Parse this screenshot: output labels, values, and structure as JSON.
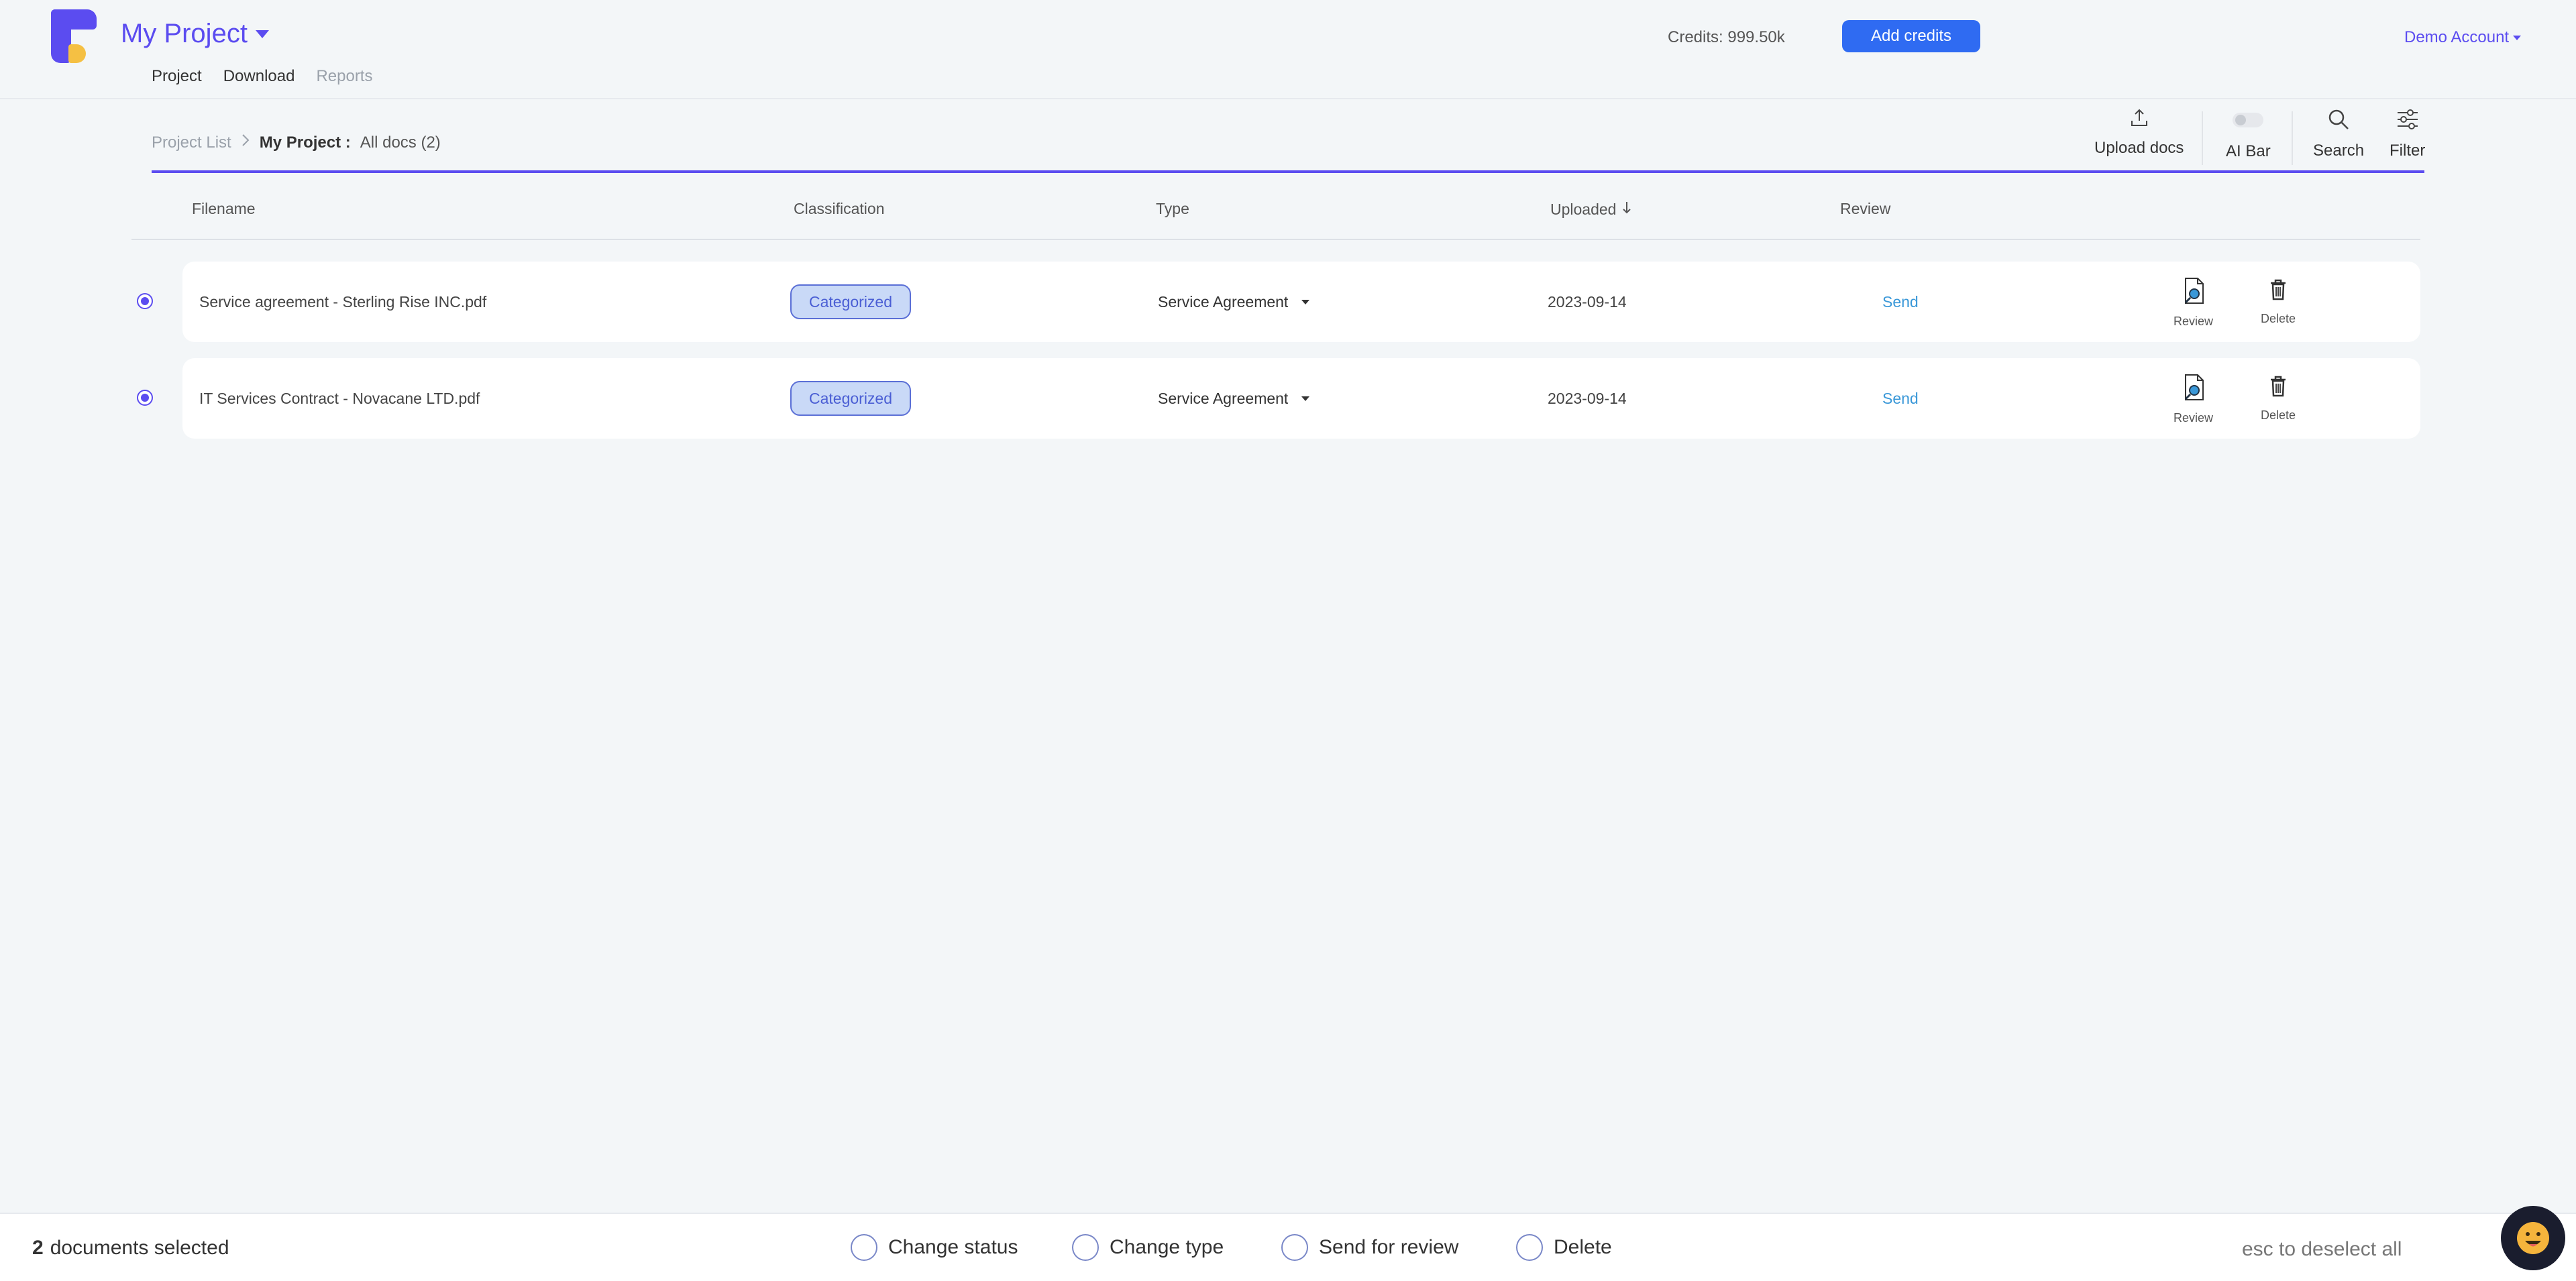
{
  "app": {
    "project_name": "My Project",
    "nav": [
      "Project",
      "Download",
      "Reports"
    ],
    "credits": "Credits: 999.50k",
    "add_credits_label": "Add credits",
    "account": "Demo Account"
  },
  "breadcrumb": {
    "root": "Project List",
    "current": "My Project :",
    "filter": "All docs (2)"
  },
  "toolbar": {
    "upload_label": "Upload docs",
    "ai_bar_label": "AI Bar",
    "ai_bar_enabled": false,
    "search_label": "Search",
    "filter_label": "Filter"
  },
  "table": {
    "columns": {
      "filename": "Filename",
      "classification": "Classification",
      "type": "Type",
      "uploaded": "Uploaded",
      "review": "Review"
    },
    "rows": [
      {
        "selected": true,
        "filename": "Service agreement - Sterling Rise INC.pdf",
        "classification": "Categorized",
        "type": "Service Agreement",
        "uploaded": "2023-09-14",
        "review": "Send",
        "review_action": "Review",
        "delete_action": "Delete"
      },
      {
        "selected": true,
        "filename": "IT Services Contract - Novacane LTD.pdf",
        "classification": "Categorized",
        "type": "Service Agreement",
        "uploaded": "2023-09-14",
        "review": "Send",
        "review_action": "Review",
        "delete_action": "Delete"
      }
    ]
  },
  "bottom_bar": {
    "selected_count": "2",
    "selected_text": "documents selected",
    "actions": [
      "Change status",
      "Change type",
      "Send for review",
      "Delete"
    ],
    "hint": "esc to deselect all"
  },
  "colors": {
    "accent": "#5b4cf0",
    "button": "#2f6bf2",
    "badge_bg": "#c9d9f7",
    "link": "#3a98d8"
  },
  "icons": [
    "upload-icon",
    "search-icon",
    "filter-icon",
    "review-icon",
    "trash-icon",
    "chat-bot-icon",
    "sort-arrow-icon",
    "chevron-right-icon"
  ]
}
